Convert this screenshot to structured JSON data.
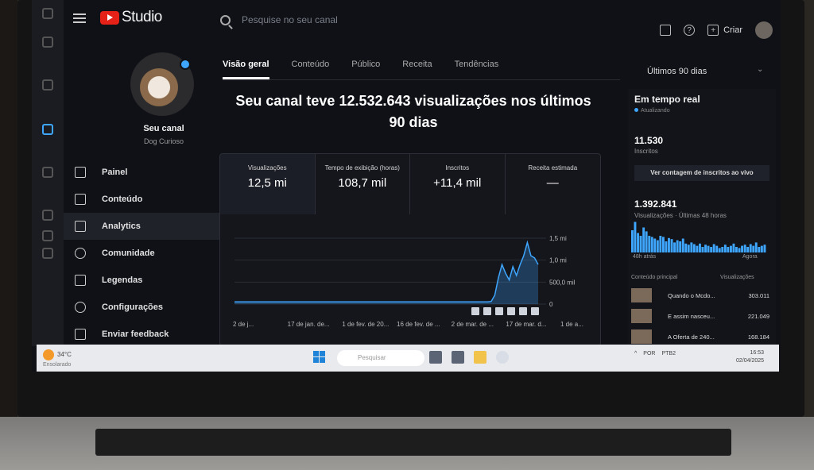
{
  "app": {
    "name": "Studio"
  },
  "search": {
    "placeholder": "Pesquise no seu canal"
  },
  "header": {
    "create_label": "Criar"
  },
  "channel": {
    "title": "Seu canal",
    "name": "Dog Curioso"
  },
  "sidebar": {
    "items": [
      {
        "label": "Painel",
        "icon": "dashboard-icon"
      },
      {
        "label": "Conteúdo",
        "icon": "content-icon"
      },
      {
        "label": "Analytics",
        "icon": "analytics-icon",
        "active": true
      },
      {
        "label": "Comunidade",
        "icon": "community-icon"
      },
      {
        "label": "Legendas",
        "icon": "subtitles-icon"
      },
      {
        "label": "Configurações",
        "icon": "gear-icon"
      },
      {
        "label": "Enviar feedback",
        "icon": "feedback-icon"
      }
    ]
  },
  "tabs": [
    {
      "label": "Visão geral",
      "active": true
    },
    {
      "label": "Conteúdo"
    },
    {
      "label": "Público"
    },
    {
      "label": "Receita"
    },
    {
      "label": "Tendências"
    }
  ],
  "headline": "Seu canal teve 12.532.643 visualizações nos últimos 90 dias",
  "metrics": [
    {
      "label": "Visualizações",
      "value": "12,5 mi"
    },
    {
      "label": "Tempo de exibição (horas)",
      "value": "108,7 mil"
    },
    {
      "label": "Inscritos",
      "value": "+11,4 mil"
    },
    {
      "label": "Receita estimada",
      "value": "—"
    }
  ],
  "chart_data": {
    "type": "area",
    "x_tick_labels": [
      "2 de j...",
      "17 de jan. de...",
      "1 de fev. de 20...",
      "16 de fev. de ...",
      "2 de mar. de ...",
      "17 de mar. d...",
      "1 de a..."
    ],
    "y_tick_labels": [
      "1,5 mi",
      "1,0 mi",
      "500,0 mil",
      "0"
    ],
    "ylim": [
      0,
      1500000
    ],
    "values": [
      50000,
      50000,
      50000,
      50000,
      50000,
      50000,
      50000,
      50000,
      50000,
      50000,
      50000,
      50000,
      50000,
      50000,
      50000,
      50000,
      50000,
      50000,
      50000,
      50000,
      50000,
      50000,
      50000,
      50000,
      50000,
      50000,
      50000,
      50000,
      50000,
      50000,
      50000,
      50000,
      50000,
      50000,
      50000,
      50000,
      50000,
      50000,
      50000,
      50000,
      50000,
      50000,
      50000,
      50000,
      50000,
      50000,
      50000,
      50000,
      50000,
      50000,
      50000,
      50000,
      50000,
      50000,
      50000,
      50000,
      50000,
      50000,
      50000,
      50000,
      50000,
      50000,
      50000,
      50000,
      50000,
      50000,
      50000,
      50000,
      50000,
      50000,
      50000,
      60000,
      200000,
      600000,
      900000,
      700000,
      550000,
      850000,
      650000,
      900000,
      1100000,
      1400000,
      1100000,
      1050000,
      900000
    ],
    "color": "#3ea6ff"
  },
  "right_panel": {
    "range": "Últimos 90 dias",
    "realtime_title": "Em tempo real",
    "updating": "Atualizando",
    "subscribers": "11.530",
    "subscribers_label": "Inscritos",
    "live_button": "Ver contagem de inscritos ao vivo",
    "views": "1.392.841",
    "views_label": "Visualizações · Últimas 48 horas",
    "ago_48": "48h atrás",
    "now": "Agora",
    "top_content": "Conteúdo principal",
    "top_views": "Visualizações",
    "bars": [
      40,
      55,
      35,
      30,
      45,
      38,
      30,
      28,
      25,
      22,
      30,
      28,
      20,
      26,
      24,
      18,
      22,
      20,
      25,
      16,
      14,
      18,
      15,
      12,
      16,
      10,
      14,
      12,
      10,
      15,
      12,
      8,
      10,
      14,
      10,
      12,
      16,
      10,
      8,
      12,
      14,
      10,
      15,
      12,
      18,
      10,
      12,
      14
    ],
    "rows": [
      {
        "title": "Quando o Mcdo...",
        "views": "303.011"
      },
      {
        "title": "E assim nasceu...",
        "views": "221.049"
      },
      {
        "title": "A Oferta de 240...",
        "views": "168.184"
      }
    ]
  },
  "taskbar": {
    "temperature": "34°C",
    "weather": "Ensolarado",
    "search_placeholder": "Pesquisar",
    "lang": "POR",
    "layout": "PTB2",
    "time": "16:53",
    "date": "02/04/2025"
  }
}
